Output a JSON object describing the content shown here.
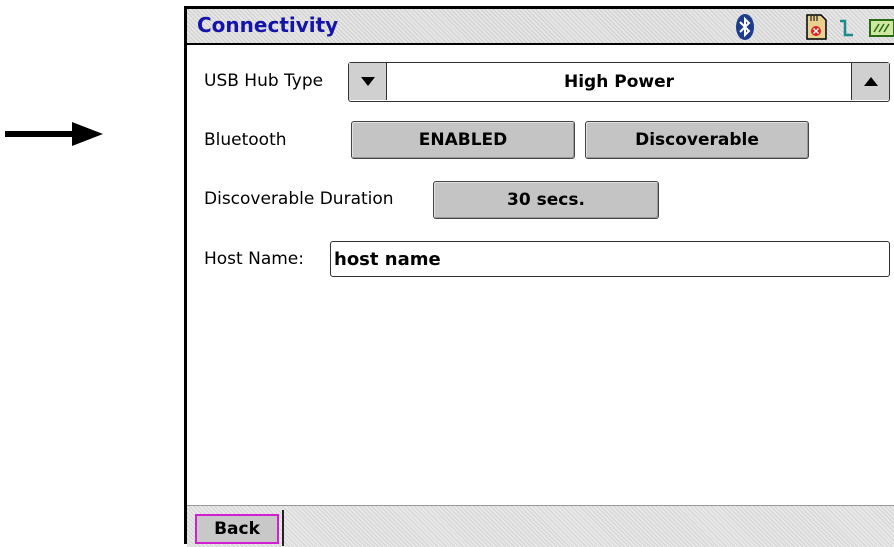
{
  "title": "Connectivity",
  "status_icons": [
    "bluetooth-icon",
    "sd-card-icon",
    "signal-icon",
    "battery-icon"
  ],
  "usb_hub": {
    "label": "USB Hub Type",
    "value": "High Power"
  },
  "bluetooth": {
    "label": "Bluetooth",
    "enabled_label": "ENABLED",
    "discoverable_label": "Discoverable"
  },
  "discoverable_duration": {
    "label": "Discoverable Duration",
    "value": "30 secs."
  },
  "host_name": {
    "label": "Host Name:",
    "value": "host name"
  },
  "footer": {
    "back_label": "Back"
  },
  "colors": {
    "title": "#1414a8",
    "bluetooth_icon": "#1e3c8c",
    "back_highlight": "#d020d0"
  }
}
